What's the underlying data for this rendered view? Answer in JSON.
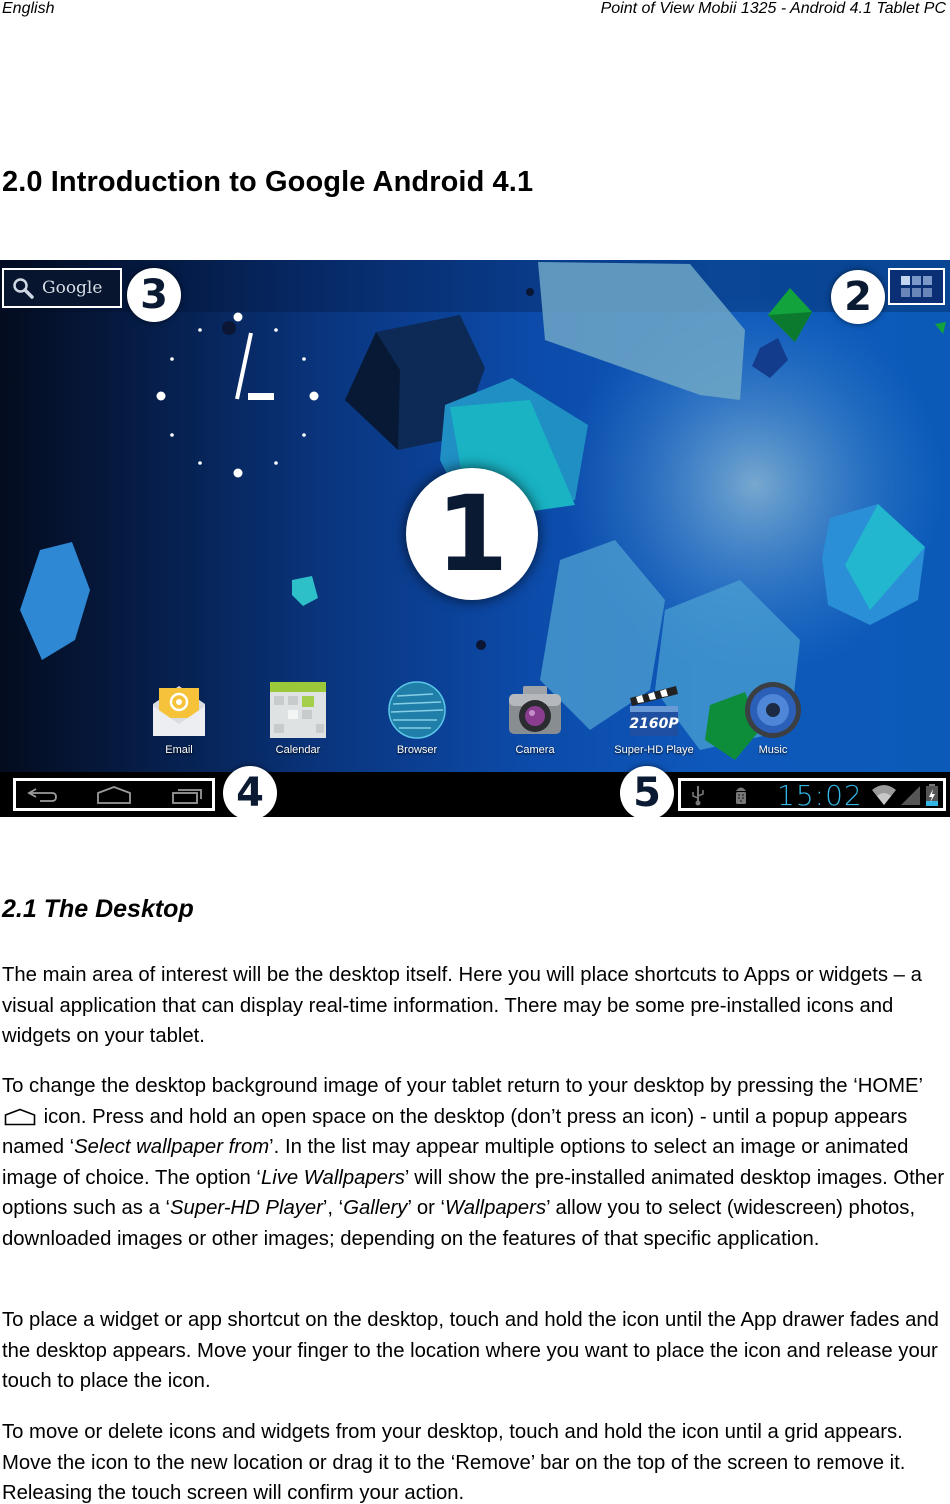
{
  "header": {
    "left": "English",
    "right": "Point of View Mobii 1325 - Android 4.1 Tablet PC"
  },
  "section": {
    "title": "2.0 Introduction to Google Android 4.1"
  },
  "screenshot": {
    "search_widget": {
      "icon": "search-icon",
      "label": "Google"
    },
    "apps_button": {
      "icon": "apps-grid-icon"
    },
    "clock_widget": {
      "type": "analog-clock",
      "hour": 3,
      "minute": 2
    },
    "callouts": [
      "1",
      "2",
      "3",
      "4",
      "5"
    ],
    "dock": [
      {
        "label": "Email",
        "icon": "email-icon"
      },
      {
        "label": "Calendar",
        "icon": "calendar-icon"
      },
      {
        "label": "Browser",
        "icon": "browser-icon"
      },
      {
        "label": "Camera",
        "icon": "camera-icon"
      },
      {
        "label": "Super-HD Playe",
        "icon": "video-player-icon",
        "icon_text": "2160P"
      },
      {
        "label": "Music",
        "icon": "music-icon"
      }
    ],
    "navbar": {
      "buttons": [
        {
          "name": "back",
          "icon": "back-icon"
        },
        {
          "name": "home",
          "icon": "home-icon"
        },
        {
          "name": "recent-apps",
          "icon": "recent-apps-icon"
        }
      ],
      "status": {
        "icons": [
          "usb-icon",
          "android-debug-icon",
          "wifi-icon",
          "signal-icon",
          "battery-charging-icon"
        ],
        "time": "15:02"
      }
    },
    "colors": {
      "clock_text": "#33b5e5",
      "navbar_bg": "#000000",
      "highlight": "#ffffff"
    }
  },
  "subsection": {
    "title": "2.1 The Desktop"
  },
  "paragraphs": {
    "p1": "The main area of interest will be the desktop itself. Here you will place shortcuts to Apps or widgets – a visual application that can display real-time information. There may be some pre-installed icons and widgets on your tablet.",
    "p2": {
      "a": "To change the desktop background image of your tablet return to your desktop by pressing the ‘HOME’",
      "b": " icon. Press and hold an open space on the desktop (don’t press an icon) - until a popup appears named ‘",
      "c": "Select wallpaper from",
      "d": "’. In the list may appear multiple options to select an image or animated image of choice. The option ‘",
      "e": "Live Wallpapers",
      "f": "’ will show the pre-installed animated desktop images. Other options such as a ‘",
      "g": "Super-HD Player",
      "h": "’, ‘",
      "i": "Gallery",
      "j": "’ or ‘",
      "k": "Wallpapers",
      "l": "’ allow you to select (widescreen) photos, downloaded images or other images; depending on the features of that specific application."
    },
    "p3": "To place a widget or app shortcut on the desktop, touch and hold the icon until the App drawer fades and the desktop appears. Move your finger to the location where you want to place the icon and release your touch to place the icon.",
    "p4": "To move or delete icons and widgets from your desktop, touch and hold the icon until a grid appears. Move the icon to the new location or drag it to the ‘Remove’ bar on the top of the screen to remove it. Releasing the touch screen will confirm your action."
  }
}
